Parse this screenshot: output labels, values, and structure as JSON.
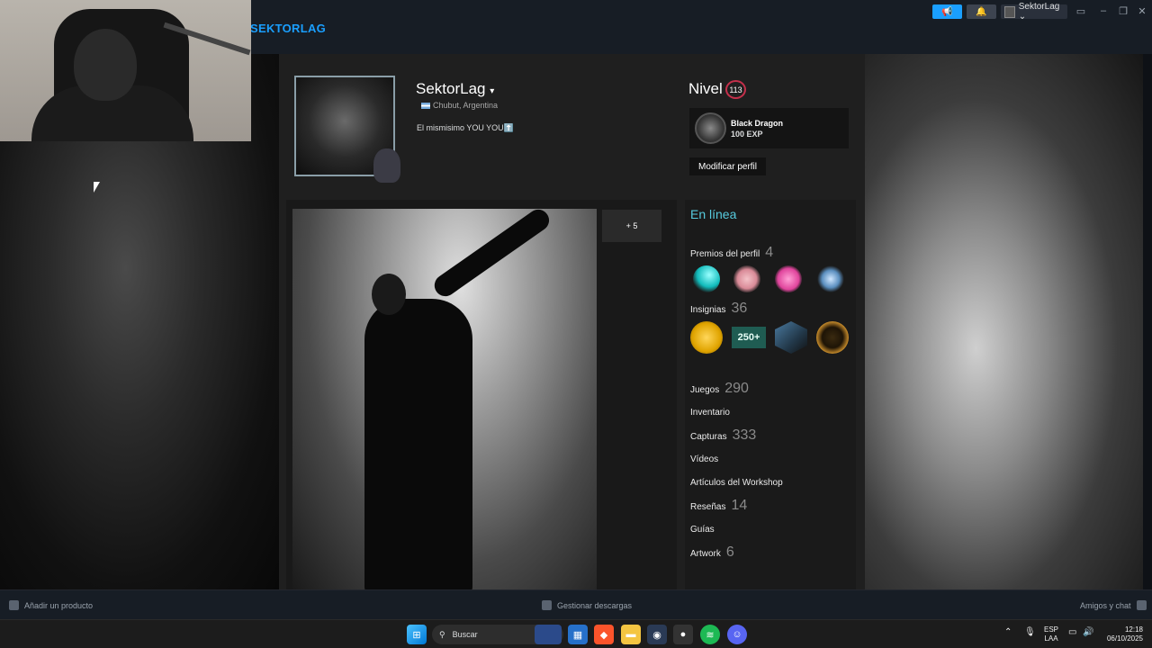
{
  "steam": {
    "title": "SEKTORLAG",
    "user_menu_label": "SektorLag ⌄"
  },
  "profile": {
    "username": "SektorLag",
    "location": "Chubut, Argentina",
    "summary": "El mismisimo YOU YOU⬆️",
    "level_label": "Nivel",
    "level": "113",
    "featured_badge": {
      "name": "Black Dragon",
      "xp": "100 EXP"
    },
    "edit_button": "Modificar perfil"
  },
  "showcase": {
    "more_label": "+ 5"
  },
  "sidebar": {
    "status": "En línea",
    "awards": {
      "label": "Premios del perfil",
      "count": "4"
    },
    "badges": {
      "label": "Insignias",
      "count": "36",
      "badge_text": "250+"
    },
    "stats": [
      {
        "label": "Juegos",
        "count": "290"
      },
      {
        "label": "Inventario",
        "count": ""
      },
      {
        "label": "Capturas",
        "count": "333"
      },
      {
        "label": "Vídeos",
        "count": ""
      },
      {
        "label": "Artículos del Workshop",
        "count": ""
      },
      {
        "label": "Reseñas",
        "count": "14"
      },
      {
        "label": "Guías",
        "count": ""
      },
      {
        "label": "Artwork",
        "count": "6"
      }
    ]
  },
  "bottombar": {
    "add_product": "Añadir un producto",
    "downloads": "Gestionar descargas",
    "friends": "Amigos y chat"
  },
  "taskbar": {
    "search_placeholder": "Buscar",
    "lang_top": "ESP",
    "lang_bottom": "LAA",
    "time": "12:18",
    "date": "06/10/2025"
  },
  "colors": {
    "accent": "#1a9fff",
    "online": "#57cbde",
    "level_ring": "#c4304b"
  }
}
